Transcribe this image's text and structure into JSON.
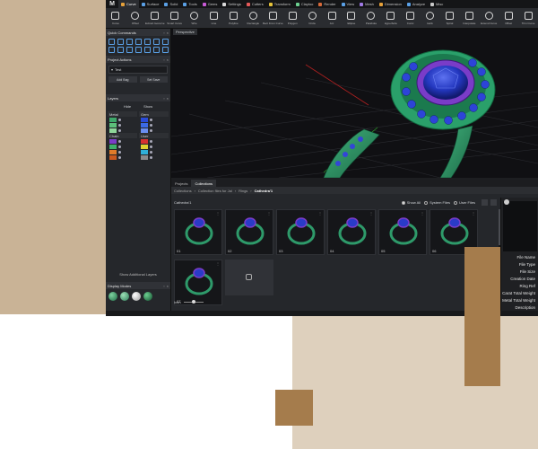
{
  "colors": {
    "accent": "#5aa0e6",
    "ring_metal": "#2e9a6a",
    "gem_blue": "#2a3bc8",
    "halo_purple": "#7a3cc8"
  },
  "app": {
    "logo": "M"
  },
  "menu": [
    "Curve",
    "Surface",
    "Solid",
    "Tools",
    "Gems",
    "Settings",
    "Cutters",
    "Transform",
    "Claytoo",
    "Render",
    "View",
    "Mesh",
    "Dimension",
    "Analyze",
    "Misc"
  ],
  "toolbar": [
    "Curve",
    "Offset",
    "Extract Isocurve",
    "Smart Curve",
    "Wire",
    "Line",
    "Polyline",
    "Rectangle",
    "Rect From Curve",
    "Polygon",
    "Circle",
    "Arc",
    "Ellipse",
    "Parabola",
    "Hyperbola",
    "Conic",
    "Helix",
    "Spiral",
    "Interpolate",
    "Extend Curve",
    "Offset",
    "Trim Curve"
  ],
  "quick_commands": {
    "title": "Quick Commands"
  },
  "project_actions": {
    "title": "Project Actions",
    "field": "Test",
    "add": "Add Bag",
    "save": "Set Save"
  },
  "layers": {
    "title": "Layers",
    "hide": "Hide",
    "show": "Show",
    "metal": "Metal",
    "gem": "Gem",
    "chain": "Chain",
    "user": "User",
    "show_more": "Show Additional Layers"
  },
  "display_modes": {
    "title": "Display Modes"
  },
  "viewport": {
    "label": "Perspective"
  },
  "collections": {
    "tabs": [
      "Projects",
      "Collections"
    ],
    "breadcrumb": [
      "Collections",
      "Collection files for Jal",
      "Rings",
      "Cathedra'1"
    ],
    "name": "Cathedra'1",
    "filters": {
      "show_all": "Show All",
      "system": "System Files",
      "user": "User Files"
    },
    "items": [
      "01",
      "02",
      "03",
      "04",
      "05",
      "06",
      "07"
    ],
    "zoom_label": "Icon"
  },
  "properties": {
    "labels": [
      "File Name",
      "File Type",
      "File Size",
      "Creation Date",
      "Ring Ref",
      "Carat Total Weight",
      "Metal Total Weight",
      "Description"
    ]
  }
}
